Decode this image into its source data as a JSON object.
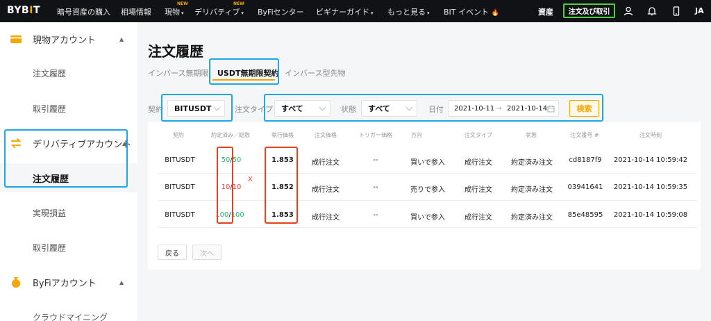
{
  "brand": {
    "logo_left": "BYB",
    "logo_accent": "I",
    "logo_right": "T",
    "accent": "#f7a600"
  },
  "nav": {
    "items": [
      {
        "label": "暗号資産の購入",
        "caret": ""
      },
      {
        "label": "相場情報",
        "caret": ""
      },
      {
        "label": "現物",
        "caret": "▾",
        "badge": "NEW"
      },
      {
        "label": "デリバティブ",
        "caret": "▾",
        "badge": "NEW"
      },
      {
        "label": "ByFiセンター",
        "caret": ""
      },
      {
        "label": "ビギナーガイド",
        "caret": "▾"
      },
      {
        "label": "もっと見る",
        "caret": "▾"
      },
      {
        "label": "BIT イベント",
        "caret": "🔥"
      }
    ],
    "assets_label": "資産",
    "trade_label": "注文及び取引",
    "lang": "JA"
  },
  "sidebar": {
    "groups": [
      {
        "label": "現物アカウント",
        "icon": "wallet-icon",
        "arrow": "▲"
      },
      {
        "label": "デリバティブアカウント",
        "icon": "swap-icon",
        "arrow": "▲"
      },
      {
        "label": "ByFiアカウント",
        "icon": "moneybag-icon",
        "arrow": "▲"
      }
    ],
    "items": [
      {
        "label": "注文履歴"
      },
      {
        "label": "取引履歴"
      },
      {
        "label": "注文履歴"
      },
      {
        "label": "実現損益"
      },
      {
        "label": "取引履歴"
      },
      {
        "label": "クラウドマイニング"
      }
    ]
  },
  "main": {
    "title": "注文履歴",
    "tabs": [
      {
        "label": "インバース無期限"
      },
      {
        "label": "USDT無期限契約"
      },
      {
        "label": "インバース型先物"
      }
    ],
    "filters": {
      "contract_label": "契約",
      "contract_value": "BITUSDT",
      "order_type_label": "注文タイプ",
      "order_type_value": "すべて",
      "status_label": "状態",
      "status_value": "すべて",
      "date_label": "日付",
      "date_from": "2021-10-11",
      "date_arrow": "→",
      "date_to": "2021-10-14",
      "search_label": "検索"
    },
    "table": {
      "headers": [
        "契約",
        "約定済み／総数",
        "執行価格",
        "注文価格",
        "トリガー価格",
        "方向",
        "注文タイプ",
        "状態",
        "注文番号 #",
        "注文時刻"
      ],
      "rows": [
        {
          "contract": "BITUSDT",
          "filled": "50",
          "total": "50",
          "exec_price": "1.853",
          "order_price": "成行注文",
          "trigger": "--",
          "side": "買いで参入",
          "type": "成行注文",
          "status": "約定済み注文",
          "order_id": "cd8187f9",
          "time": "2021-10-14 10:59:42"
        },
        {
          "contract": "BITUSDT",
          "filled": "10",
          "total": "10",
          "exec_price": "1.852",
          "order_price": "成行注文",
          "trigger": "--",
          "side": "売りで参入",
          "type": "成行注文",
          "status": "約定済み注文",
          "order_id": "03941641",
          "time": "2021-10-14 10:59:35"
        },
        {
          "contract": "BITUSDT",
          "filled": "100",
          "total": "100",
          "exec_price": "1.853",
          "order_price": "成行注文",
          "trigger": "--",
          "side": "買いで参入",
          "type": "成行注文",
          "status": "約定済み注文",
          "order_id": "85e48595",
          "time": "2021-10-14 10:59:08"
        }
      ],
      "annotation": "X"
    },
    "pagination": {
      "prev": "戻る",
      "next": "次へ"
    }
  },
  "colors": {
    "highlight_blue": "#1ea6e6",
    "highlight_red": "#e8401c",
    "buy_green": "#2bb673",
    "sell_red": "#e5423c",
    "trade_outline": "#4cd137"
  }
}
